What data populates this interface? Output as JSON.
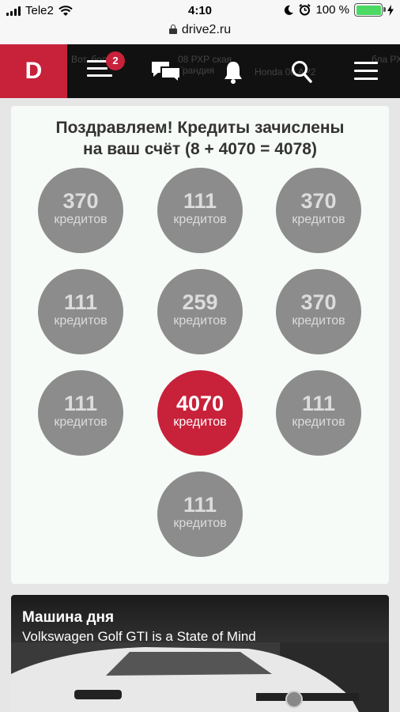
{
  "status_bar": {
    "carrier": "Tele2",
    "time": "4:10",
    "battery": "100 %"
  },
  "browser": {
    "url": "drive2.ru"
  },
  "nav": {
    "logo": "D",
    "notifications_count": "2",
    "ghost_text": [
      "Вот, бол",
      "08 РХР ская Грандия",
      "Honda 00 AP2",
      "бла РХ ите"
    ]
  },
  "credits": {
    "title_line1": "Поздравляем! Кредиты зачислены",
    "title_line2": "на ваш счёт (8 + 4070 = 4078)",
    "unit": "кредитов",
    "amounts": [
      "370",
      "111",
      "370",
      "111",
      "259",
      "370",
      "111",
      "4070",
      "111",
      "111"
    ],
    "selected_index": 7,
    "colors": {
      "coin": "#8c8c8c",
      "selected": "#c8213a"
    }
  },
  "car_of_day": {
    "title": "Машина дня",
    "subtitle": "Volkswagen Golf GTI is a State of Mind"
  },
  "colors": {
    "brand": "#c8213a",
    "nav_bg": "#111111",
    "battery": "#4cd964"
  }
}
